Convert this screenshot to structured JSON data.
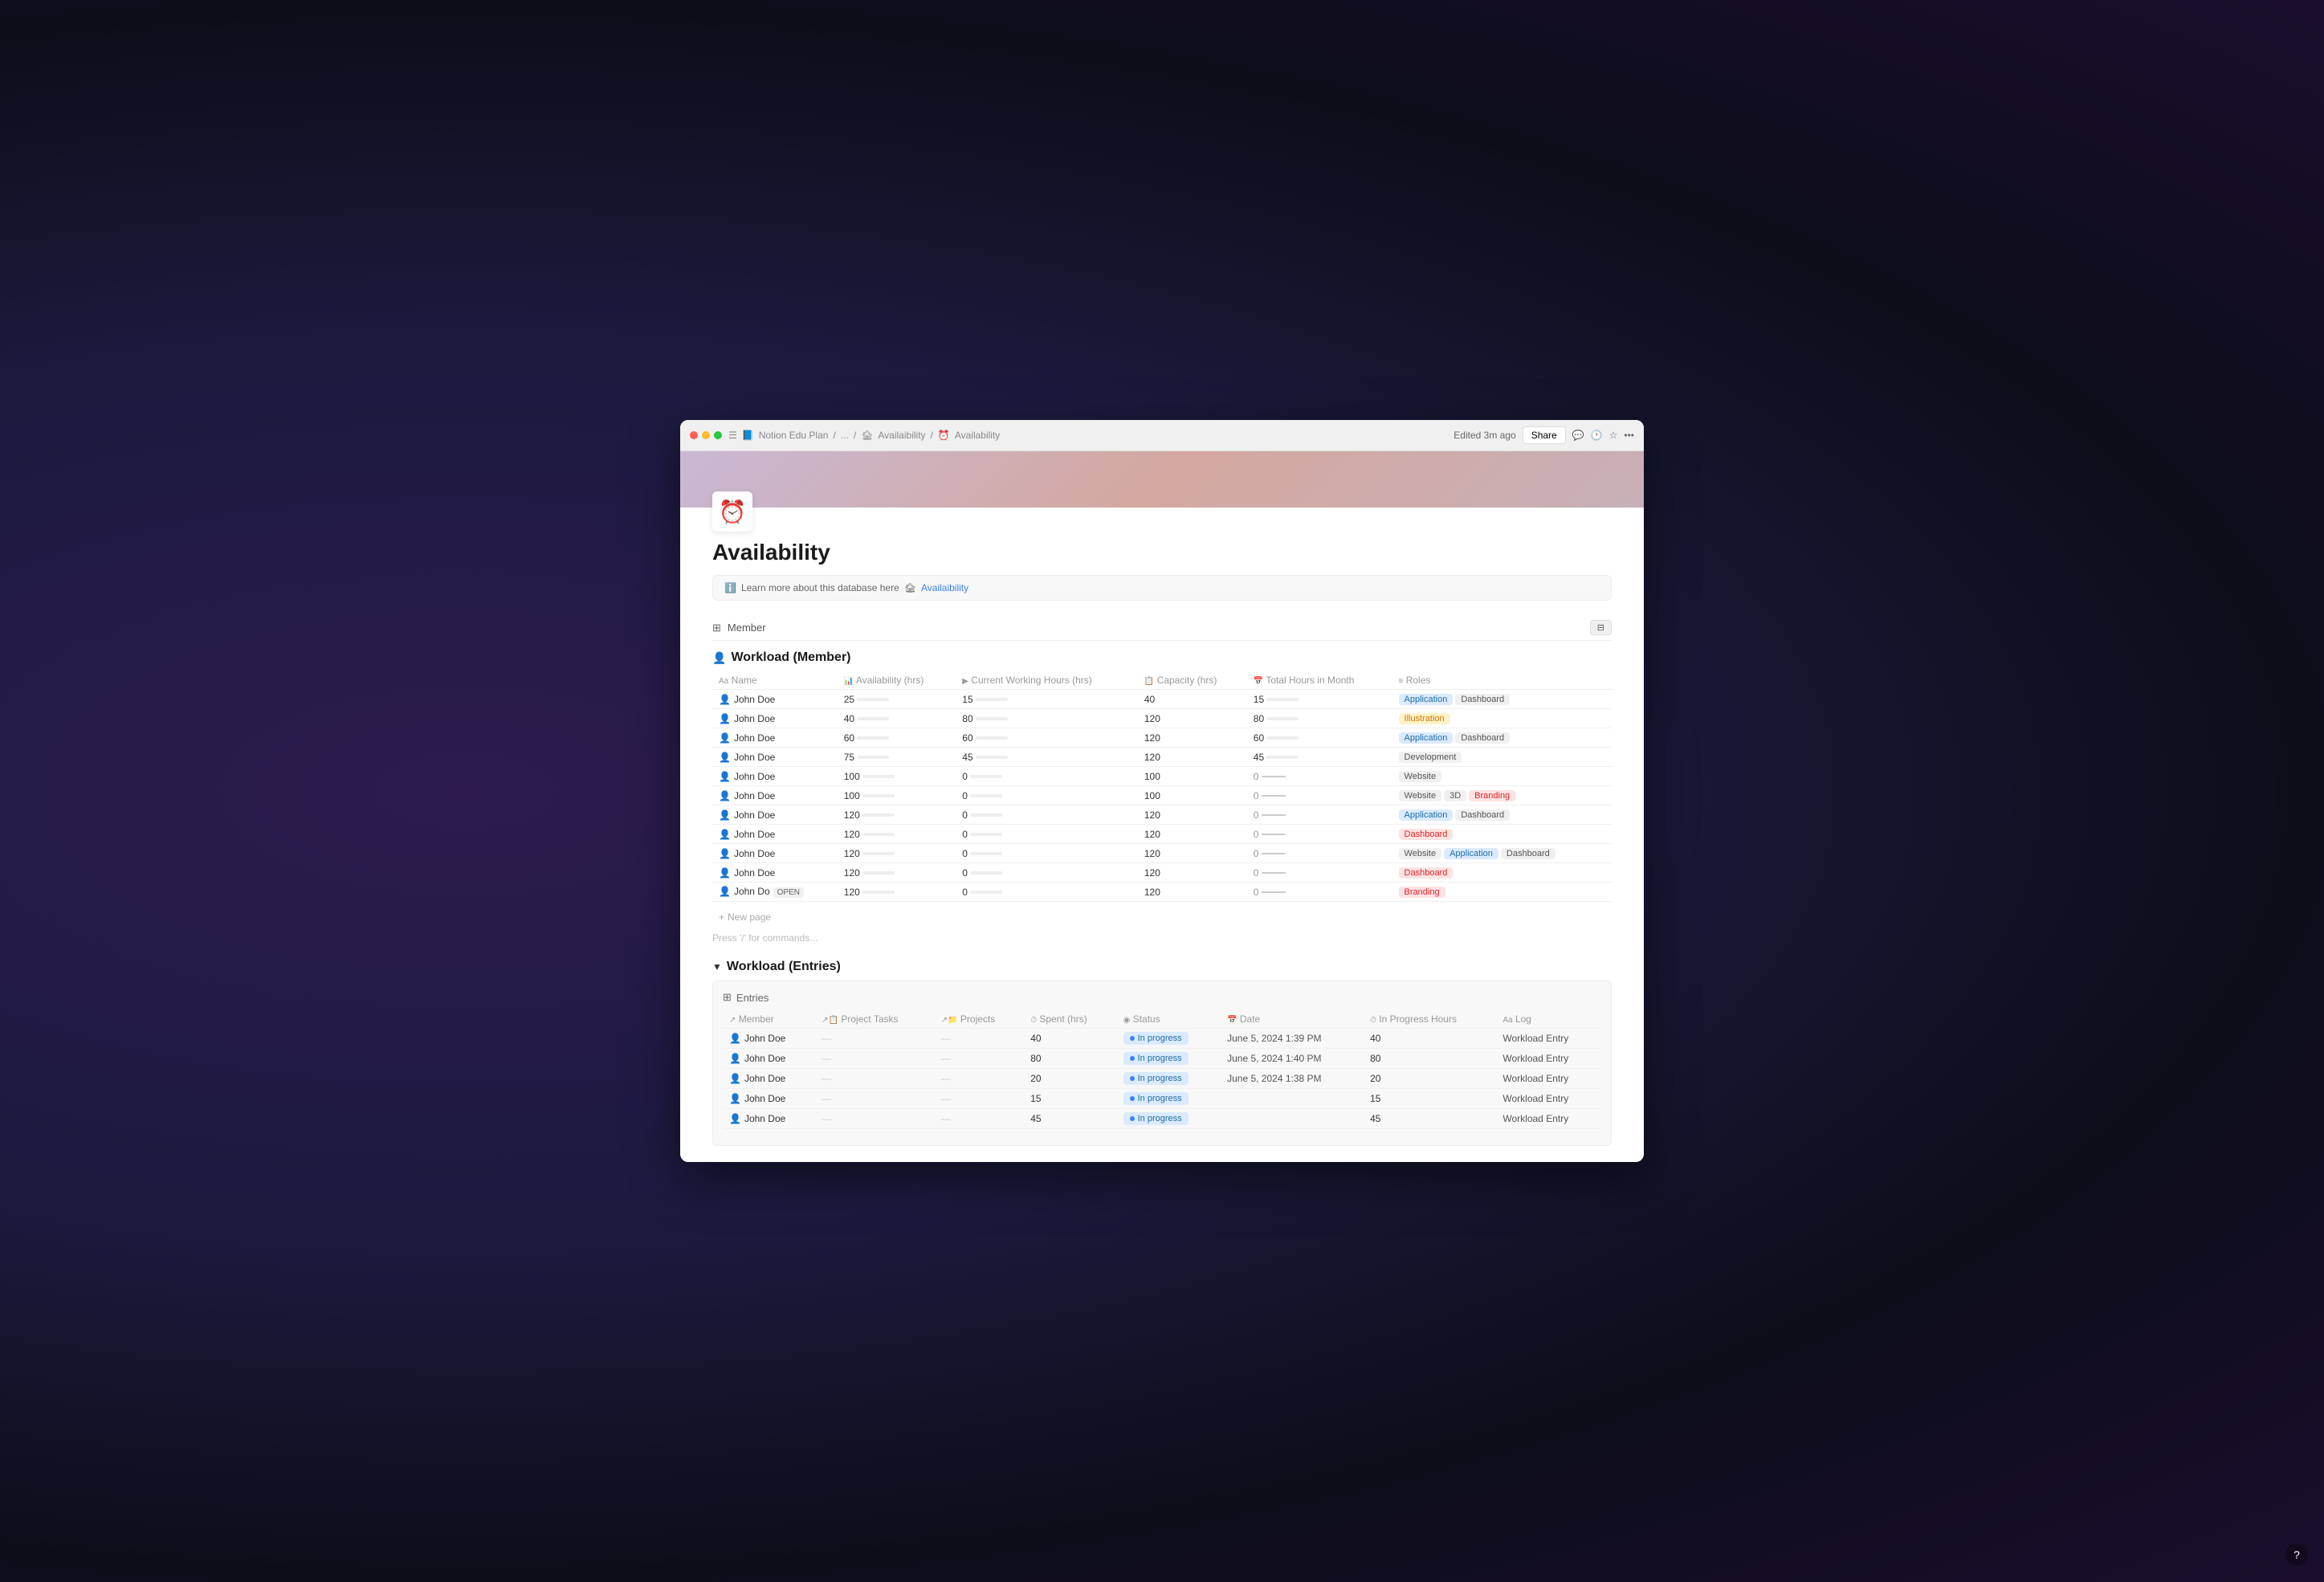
{
  "browser": {
    "breadcrumb": [
      "Notion Edu Plan",
      "/",
      "...",
      "/",
      "Availaibility",
      "/",
      "Availability"
    ],
    "edited": "Edited 3m ago",
    "share": "Share"
  },
  "page": {
    "icon": "⏰",
    "title": "Availability",
    "info_text": "Learn more about this database here",
    "info_link": "🏚 Availaibility"
  },
  "member_section": {
    "label": "Member"
  },
  "workload_member": {
    "title": "Workload (Member)",
    "columns": [
      "Name",
      "Availability (hrs)",
      "Current Working Hours (hrs)",
      "Capacity (hrs)",
      "Total Hours in Month",
      "Roles"
    ],
    "rows": [
      {
        "name": "John Doe",
        "availability": 25,
        "availability_pct": 25,
        "current": 15,
        "current_color": "green",
        "capacity": 40,
        "total": 15,
        "total_color": "green",
        "roles": [
          {
            "label": "Application",
            "type": "blue"
          },
          {
            "label": "Dashboard",
            "type": "gray"
          }
        ]
      },
      {
        "name": "John Doe",
        "availability": 40,
        "availability_pct": 40,
        "current": 80,
        "current_color": "red",
        "capacity": 120,
        "total": 80,
        "total_color": "green",
        "roles": [
          {
            "label": "Illustration",
            "type": "orange"
          }
        ]
      },
      {
        "name": "John Doe",
        "availability": 60,
        "availability_pct": 60,
        "current": 60,
        "current_color": "red",
        "capacity": 120,
        "total": 60,
        "total_color": "green",
        "roles": [
          {
            "label": "Application",
            "type": "blue"
          },
          {
            "label": "Dashboard",
            "type": "gray"
          }
        ]
      },
      {
        "name": "John Doe",
        "availability": 75,
        "availability_pct": 75,
        "current": 45,
        "current_color": "red",
        "capacity": 120,
        "total": 45,
        "total_color": "green",
        "roles": [
          {
            "label": "Development",
            "type": "gray"
          }
        ]
      },
      {
        "name": "John Doe",
        "availability": 100,
        "availability_pct": 100,
        "current": 0,
        "current_color": "green",
        "capacity": 100,
        "total": 0,
        "total_color": "dash",
        "roles": [
          {
            "label": "Website",
            "type": "gray"
          }
        ]
      },
      {
        "name": "John Doe",
        "availability": 100,
        "availability_pct": 100,
        "current": 0,
        "current_color": "green",
        "capacity": 100,
        "total": 0,
        "total_color": "dash",
        "roles": [
          {
            "label": "Website",
            "type": "gray"
          },
          {
            "label": "3D",
            "type": "gray"
          },
          {
            "label": "Branding",
            "type": "red-soft"
          }
        ]
      },
      {
        "name": "John Doe",
        "availability": 120,
        "availability_pct": 100,
        "current": 0,
        "current_color": "green",
        "capacity": 120,
        "total": 0,
        "total_color": "dash",
        "roles": [
          {
            "label": "Application",
            "type": "blue"
          },
          {
            "label": "Dashboard",
            "type": "gray"
          }
        ]
      },
      {
        "name": "John Doe",
        "availability": 120,
        "availability_pct": 100,
        "current": 0,
        "current_color": "green",
        "capacity": 120,
        "total": 0,
        "total_color": "dash",
        "roles": [
          {
            "label": "Dashboard",
            "type": "red-soft"
          }
        ]
      },
      {
        "name": "John Doe",
        "availability": 120,
        "availability_pct": 100,
        "current": 0,
        "current_color": "green",
        "capacity": 120,
        "total": 0,
        "total_color": "dash",
        "roles": [
          {
            "label": "Website",
            "type": "gray"
          },
          {
            "label": "Application",
            "type": "blue"
          },
          {
            "label": "Dashboard",
            "type": "gray"
          }
        ]
      },
      {
        "name": "John Doe",
        "availability": 120,
        "availability_pct": 100,
        "current": 0,
        "current_color": "green",
        "capacity": 120,
        "total": 0,
        "total_color": "dash",
        "roles": [
          {
            "label": "Dashboard",
            "type": "red-soft"
          }
        ]
      },
      {
        "name": "John Do",
        "open": true,
        "availability": 120,
        "availability_pct": 100,
        "current": 0,
        "current_color": "green",
        "capacity": 120,
        "total": 0,
        "total_color": "dash",
        "roles": [
          {
            "label": "Branding",
            "type": "red-soft"
          }
        ]
      }
    ],
    "new_page": "+ New page"
  },
  "commands_hint": "Press '/' for commands...",
  "workload_entries": {
    "title": "Workload (Entries)",
    "entries_label": "Entries",
    "columns": [
      "Member",
      "Project Tasks",
      "Projects",
      "Spent (hrs)",
      "Status",
      "Date",
      "In Progress Hours",
      "Log"
    ],
    "rows": [
      {
        "member": "John Doe",
        "spent": 40,
        "status": "In progress",
        "date": "June 5, 2024 1:39 PM",
        "in_progress": 40,
        "log": "Workload Entry"
      },
      {
        "member": "John Doe",
        "spent": 80,
        "status": "In progress",
        "date": "June 5, 2024 1:40 PM",
        "in_progress": 80,
        "log": "Workload Entry"
      },
      {
        "member": "John Doe",
        "spent": 20,
        "status": "In progress",
        "date": "June 5, 2024 1:38 PM",
        "in_progress": 20,
        "log": "Workload Entry"
      },
      {
        "member": "John Doe",
        "spent": 15,
        "status": "In progress",
        "date": "",
        "in_progress": 15,
        "log": "Workload Entry"
      },
      {
        "member": "John Doe",
        "spent": 45,
        "status": "In progress",
        "date": "",
        "in_progress": 45,
        "log": "Workload Entry"
      }
    ]
  },
  "tags": {
    "Application": "blue",
    "Dashboard_gray": "gray",
    "Illustration": "orange",
    "Development": "gray",
    "Website": "gray",
    "3D": "gray",
    "Branding": "red-soft",
    "Dashboard_red": "red-soft"
  }
}
